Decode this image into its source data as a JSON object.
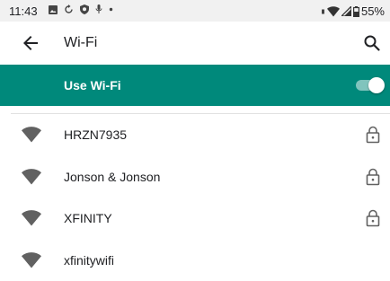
{
  "status_bar": {
    "time": "11:43",
    "battery": "55%",
    "notification_icons": [
      "image-icon",
      "sync-icon",
      "shield-icon",
      "mic-icon",
      "dot-icon"
    ],
    "system_icons": [
      "vibrate-icon",
      "wifi-icon",
      "cell-signal-icon",
      "battery-icon"
    ]
  },
  "app_bar": {
    "title": "Wi-Fi",
    "back_icon": "back-arrow-icon",
    "search_icon": "search-icon"
  },
  "master_switch": {
    "label": "Use Wi-Fi",
    "state": "on",
    "background": "#00897b"
  },
  "networks": [
    {
      "ssid": "HRZN7935",
      "secured": true
    },
    {
      "ssid": "Jonson & Jonson",
      "secured": true
    },
    {
      "ssid": "XFINITY",
      "secured": true
    },
    {
      "ssid": "xfinitywifi",
      "secured": false
    }
  ]
}
